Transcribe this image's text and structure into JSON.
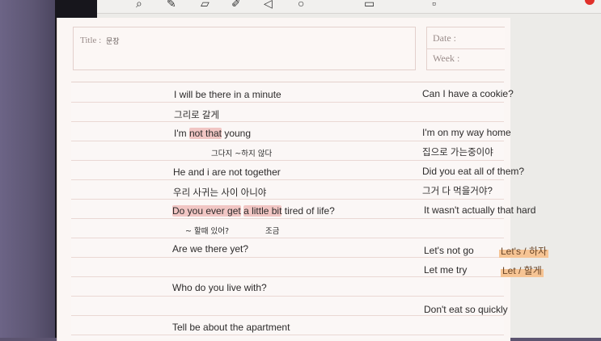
{
  "header": {
    "title_label": "Title :",
    "title_value": "문장",
    "date_label": "Date :",
    "week_label": "Week :"
  },
  "toolbar": {
    "icons": [
      "zoom-icon",
      "pen-icon",
      "eraser-icon",
      "highlighter-icon",
      "lasso-icon",
      "shape-icon",
      "image-icon",
      "more-icon",
      "record-icon"
    ]
  },
  "left": {
    "s1": "I will be there in a minute",
    "k1": "그리로 갈게",
    "s2_a": "I'm ",
    "s2_hl": "not that",
    "s2_b": " young",
    "h2": "그다지 ~하지 않다",
    "s3": "He and i are not together",
    "k3": "우리 사귀는 사이 아니야",
    "s4_hl1": "Do you ever get",
    "s4_hl2": "a little bit",
    "s4_b": " tired of life?",
    "h4a": "~ 할때 있어?",
    "h4b": "조금",
    "s5": "Are we there yet?",
    "s6": "Who do you live with?",
    "s7": "Tell be about the apartment"
  },
  "right": {
    "s1": "Can I have a cookie?",
    "s2": "I'm on my way home",
    "k2": "집으로 가는중이야",
    "s3": "Did you eat all of them?",
    "k3": "그거 다 먹을거야?",
    "s4": "It wasn't actually that hard",
    "s5": "Let's not go",
    "n5": "Let's / 하자",
    "s6": "Let me try",
    "n6": "Let / 할게",
    "s7": "Don't eat so quickly"
  },
  "colors": {
    "highlight_pink": "#f1c6c4",
    "highlight_orange": "#f6c494",
    "paper": "#fbf6f4"
  }
}
